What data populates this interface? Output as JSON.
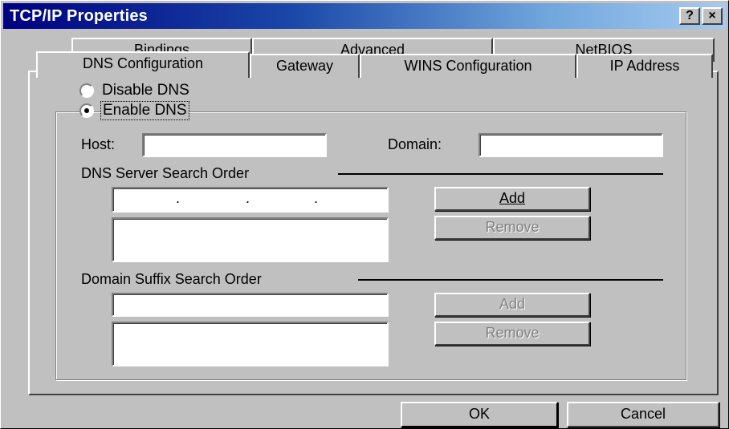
{
  "window": {
    "title": "TCP/IP Properties",
    "help_label": "?",
    "close_label": "×"
  },
  "tabs": {
    "back_row": [
      "Bindings",
      "Advanced",
      "NetBIOS"
    ],
    "front_row": [
      "DNS Configuration",
      "Gateway",
      "WINS Configuration",
      "IP Address"
    ],
    "active": "DNS Configuration"
  },
  "dns": {
    "disable_label": "Disable DNS",
    "enable_label": "Enable DNS",
    "selected": "enable"
  },
  "fields": {
    "host_label": "Host:",
    "host_value": "",
    "domain_label": "Domain:",
    "domain_value": ""
  },
  "dns_server": {
    "label": "DNS Server Search Order",
    "ip_separator": ".",
    "add_label": "Add",
    "remove_label": "Remove"
  },
  "domain_suffix": {
    "label": "Domain Suffix Search Order",
    "add_label": "Add",
    "remove_label": "Remove"
  },
  "footer": {
    "ok_label": "OK",
    "cancel_label": "Cancel"
  },
  "colors": {
    "face": "#c0c0c0",
    "title_start": "#000080",
    "title_end": "#a6caf0"
  }
}
